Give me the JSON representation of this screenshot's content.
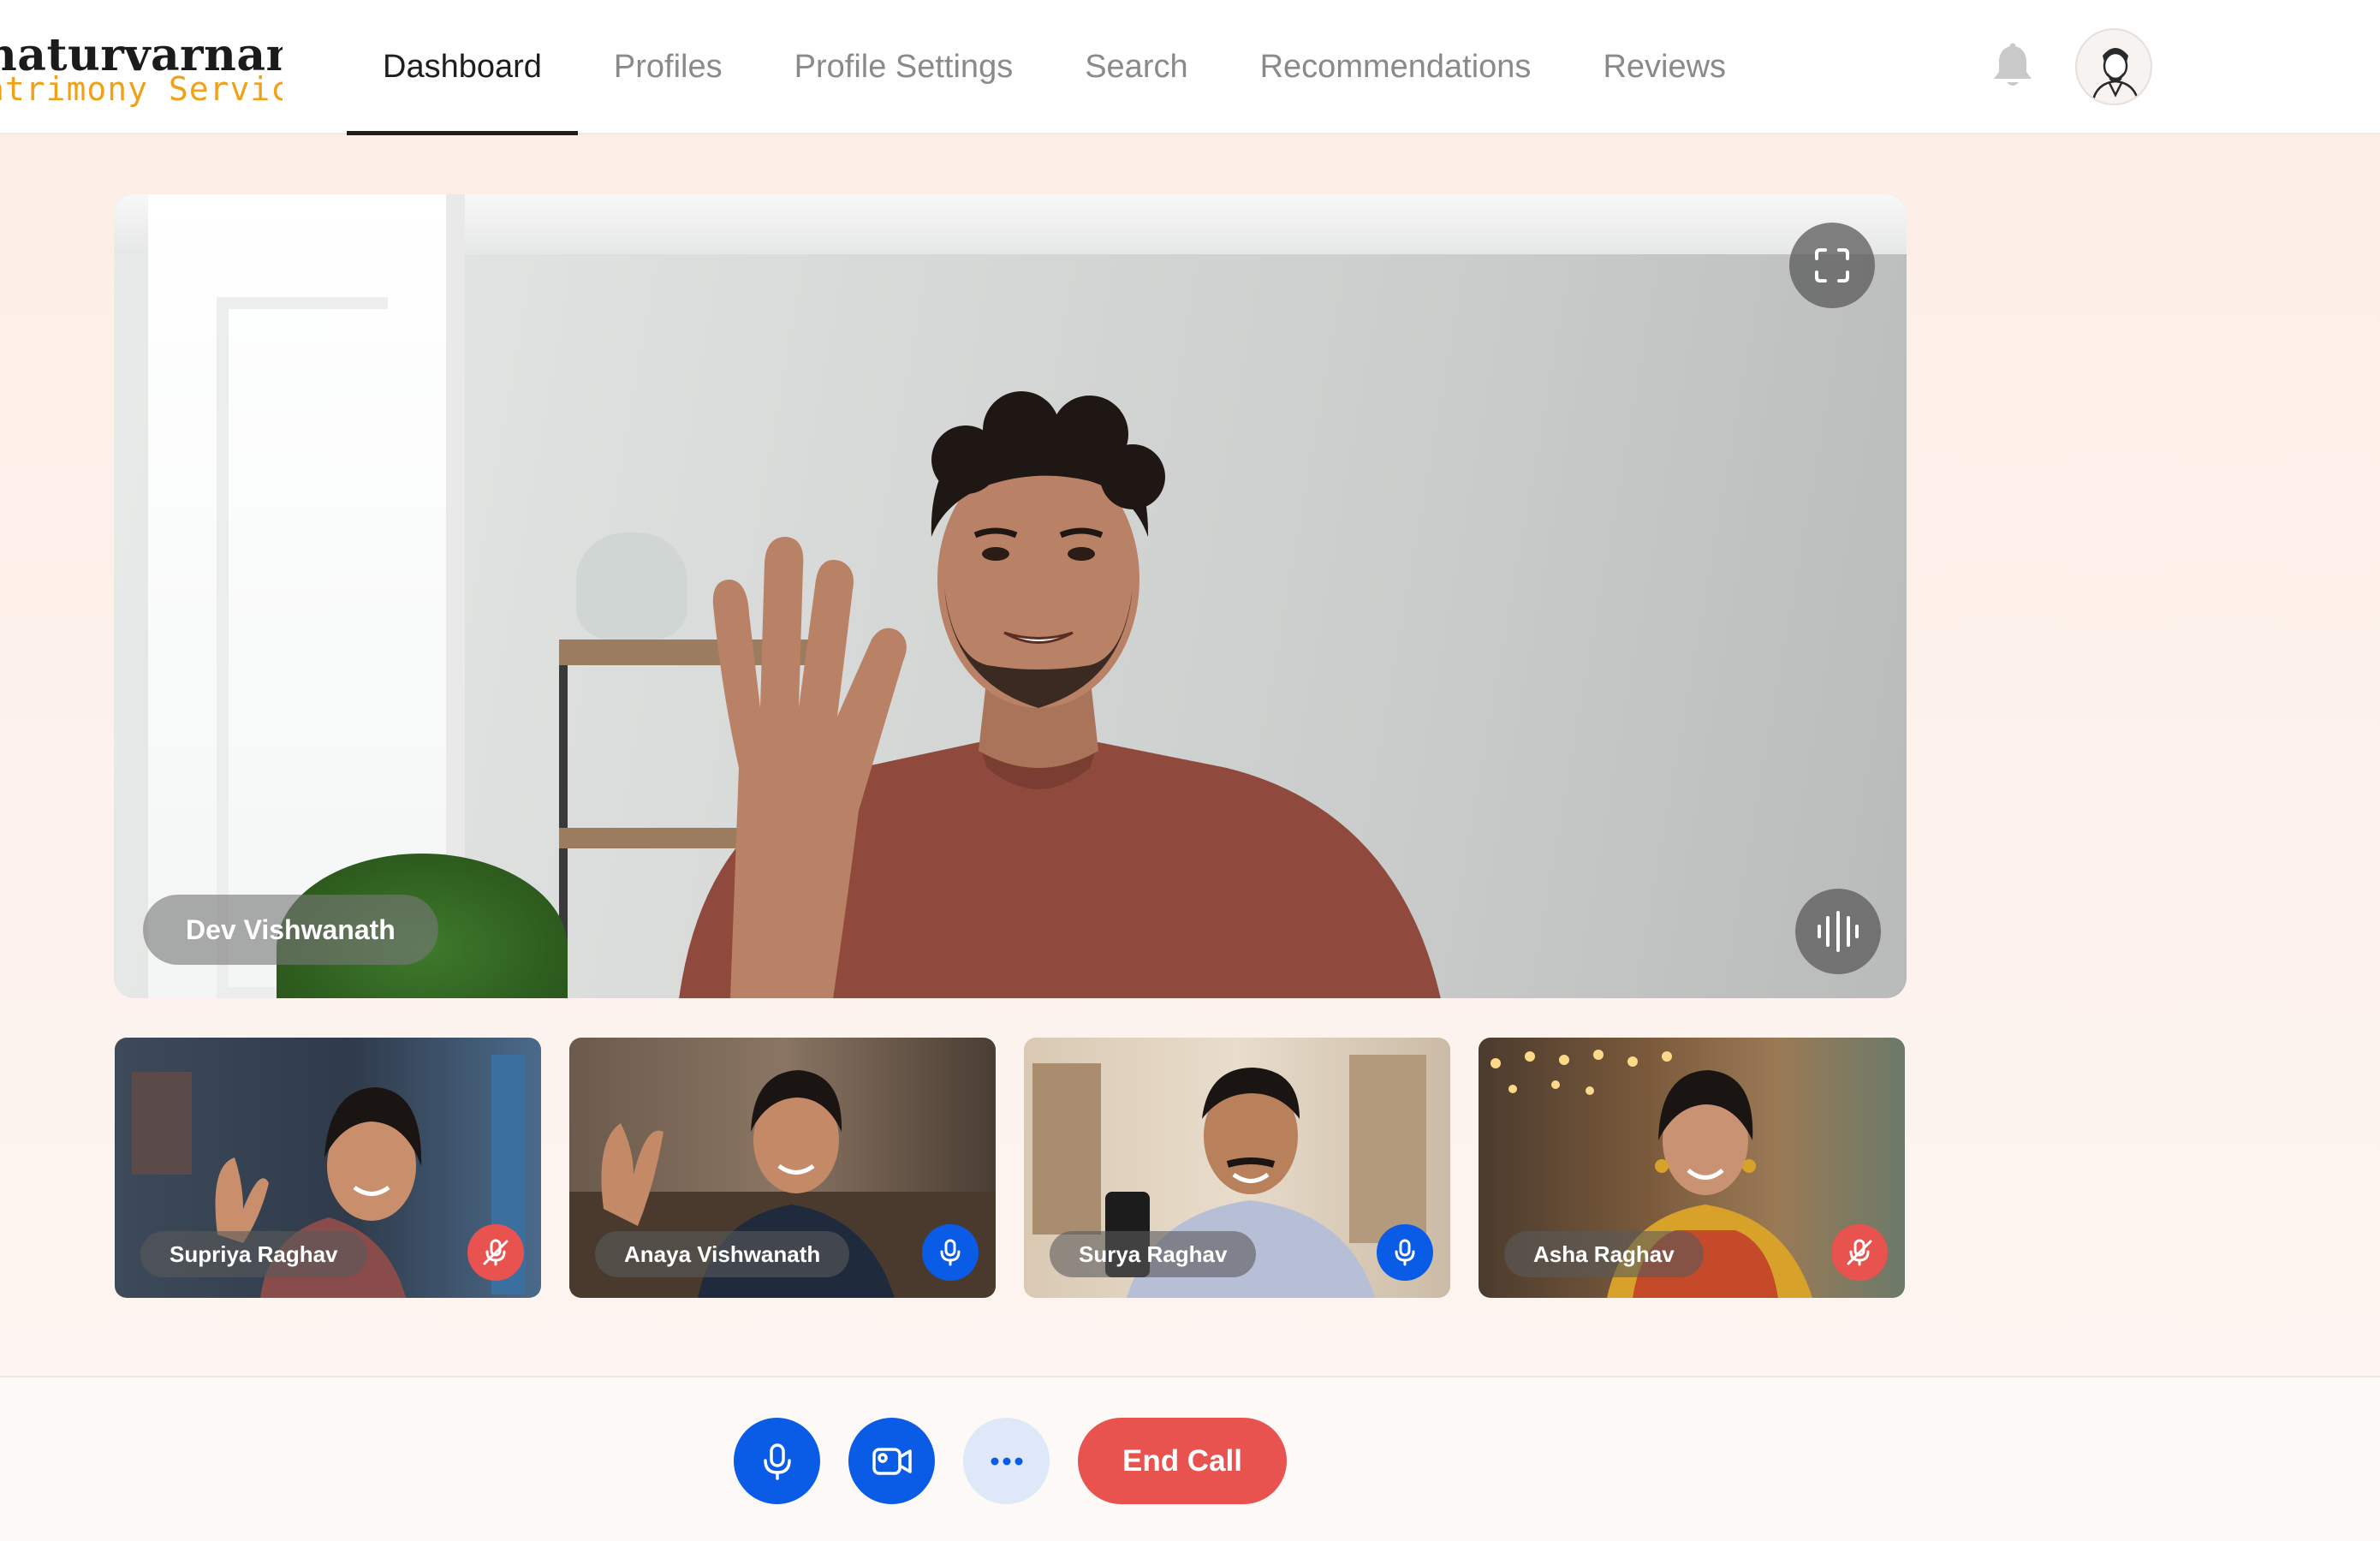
{
  "brand": {
    "name_line1": "haturvarnam",
    "name_line2": "atrimony Services",
    "accent_color": "#f0a11a"
  },
  "nav": {
    "items": [
      {
        "label": "Dashboard",
        "active": true
      },
      {
        "label": "Profiles",
        "active": false
      },
      {
        "label": "Profile Settings",
        "active": false
      },
      {
        "label": "Search",
        "active": false
      },
      {
        "label": "Recommendations",
        "active": false
      },
      {
        "label": "Reviews",
        "active": false
      }
    ],
    "icons": [
      "bell-icon",
      "user-avatar"
    ]
  },
  "main_video": {
    "participant_name": "Dev Vishwanath",
    "icons": [
      "fullscreen-icon",
      "audio-waveform-icon"
    ]
  },
  "participants": [
    {
      "name": "Supriya Raghav",
      "mic": "muted",
      "mic_color": "#e8524f"
    },
    {
      "name": "Anaya Vishwanath",
      "mic": "on",
      "mic_color": "#0a5ce6"
    },
    {
      "name": "Surya Raghav",
      "mic": "on",
      "mic_color": "#0a5ce6"
    },
    {
      "name": "Asha Raghav",
      "mic": "muted",
      "mic_color": "#e8524f"
    }
  ],
  "controls": {
    "mic_icon": "microphone-icon",
    "camera_icon": "video-camera-icon",
    "more_icon": "more-options-icon",
    "end_call_label": "End Call",
    "primary_color": "#0a5ce6",
    "end_call_color": "#e8524f"
  }
}
